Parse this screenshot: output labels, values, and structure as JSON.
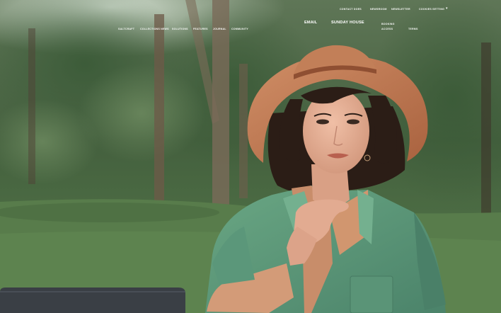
{
  "nav": {
    "left_links": [
      "SALTCRAFT",
      "COLLECTIONS NEWS",
      "SOLUTIONS",
      "FEATURES",
      "JOURNAL",
      "COMMUNITY"
    ],
    "brand": "SUNDAY HOUSE",
    "brand_prefix": "EMAIL",
    "right_links_top": [
      "CONTACT DOES",
      "NEWSROOM",
      "NEWSLETTER",
      "COOKIES SETTING"
    ],
    "right_links_bottom": [
      "BOOKING",
      "ACCESS",
      "TERMS"
    ],
    "menu_icon": "menu-icon"
  },
  "colors": {
    "sky": "#c9d6c8",
    "foliage_dark": "#2f4a2d",
    "grass": "#56794a",
    "hat": "#c47e57",
    "shirt": "#5f9a77",
    "undershirt": "#c88d6a",
    "skin": "#e4ad94",
    "hair": "#2b1d16",
    "laptop": "#3b3f44"
  }
}
